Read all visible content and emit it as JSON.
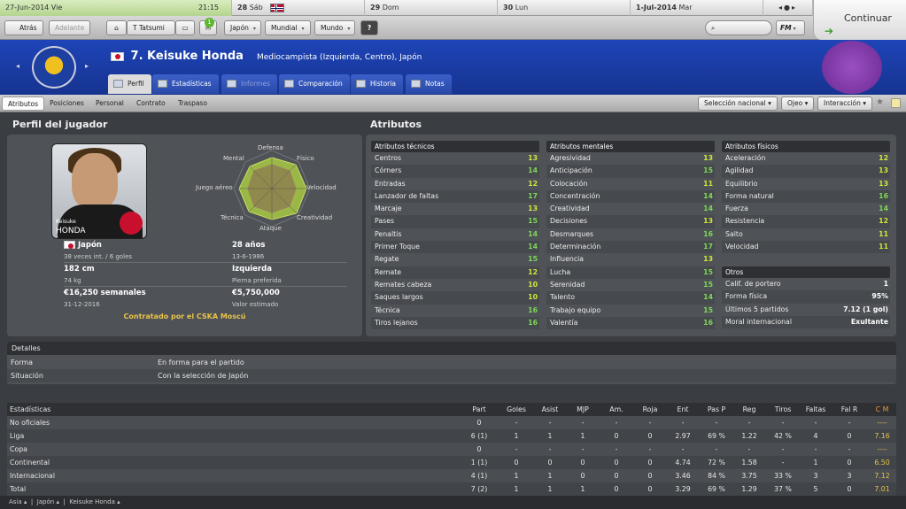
{
  "datebar": {
    "current_date": "27-Jun-2014 Vie",
    "time": "21:15",
    "days": [
      {
        "num": "28",
        "day": "Sáb"
      },
      {
        "num": "29",
        "day": "Dom"
      },
      {
        "num": "30",
        "day": "Lun"
      },
      {
        "num": "1-Jul-2014",
        "day": "Mar"
      }
    ]
  },
  "toolbar": {
    "back": "Atrás",
    "forward": "Adelante",
    "manager": "T Tatsumi",
    "badge": "1",
    "nav": [
      "Japón",
      "Mundial",
      "Mundo"
    ],
    "help": "?",
    "fm": "FM",
    "continue": "Continuar"
  },
  "header": {
    "player_number_name": "7. Keisuke Honda",
    "description": "Mediocampista (Izquierda, Centro), Japón",
    "tabs": [
      {
        "label": "Perfil"
      },
      {
        "label": "Estadísticas"
      },
      {
        "label": "Informes"
      },
      {
        "label": "Comparación"
      },
      {
        "label": "Historia"
      },
      {
        "label": "Notas"
      }
    ]
  },
  "subnav": {
    "items": [
      "Atributos",
      "Posiciones",
      "Personal",
      "Contrato",
      "Traspaso"
    ],
    "buttons": [
      "Selección nacional",
      "Ojeo",
      "Interacción"
    ]
  },
  "profile": {
    "title": "Perfil del jugador",
    "photo_first": "Keisuke",
    "photo_last": "HONDA",
    "radar": {
      "top": "Defensa",
      "tr": "Físico",
      "r": "Velocidad",
      "br": "Creatividad",
      "b": "Ataque",
      "bl": "Técnica",
      "l": "Juego aéreo",
      "tl": "Mental"
    },
    "nation": "Japón",
    "caps": "38 veces int. / 6 goles",
    "age": "28 años",
    "dob": "13-6-1986",
    "height": "182 cm",
    "weight": "74 kg",
    "foot": "Izquierda",
    "foot_label": "Pierna preferida",
    "wage": "€16,250 semanales",
    "contract_end": "31-12-2016",
    "value": "€5,750,000",
    "value_label": "Valor estimado",
    "contracted": "Contratado por el CSKA Moscú"
  },
  "attributes": {
    "title": "Atributos",
    "technical": {
      "header": "Atributos técnicos",
      "rows": [
        [
          "Centros",
          "13"
        ],
        [
          "Córners",
          "14"
        ],
        [
          "Entradas",
          "12"
        ],
        [
          "Lanzador de faltas",
          "17"
        ],
        [
          "Marcaje",
          "13"
        ],
        [
          "Pases",
          "15"
        ],
        [
          "Penaltis",
          "14"
        ],
        [
          "Primer Toque",
          "14"
        ],
        [
          "Regate",
          "15"
        ],
        [
          "Remate",
          "12"
        ],
        [
          "Remates cabeza",
          "10"
        ],
        [
          "Saques largos",
          "10"
        ],
        [
          "Técnica",
          "16"
        ],
        [
          "Tiros lejanos",
          "16"
        ]
      ]
    },
    "mental": {
      "header": "Atributos mentales",
      "rows": [
        [
          "Agresividad",
          "13"
        ],
        [
          "Anticipación",
          "15"
        ],
        [
          "Colocación",
          "11"
        ],
        [
          "Concentración",
          "14"
        ],
        [
          "Creatividad",
          "14"
        ],
        [
          "Decisiones",
          "13"
        ],
        [
          "Desmarques",
          "16"
        ],
        [
          "Determinación",
          "17"
        ],
        [
          "Influencia",
          "13"
        ],
        [
          "Lucha",
          "15"
        ],
        [
          "Serenidad",
          "15"
        ],
        [
          "Talento",
          "14"
        ],
        [
          "Trabajo equipo",
          "15"
        ],
        [
          "Valentía",
          "16"
        ]
      ]
    },
    "physical": {
      "header": "Atributos físicos",
      "rows": [
        [
          "Aceleración",
          "12"
        ],
        [
          "Agilidad",
          "13"
        ],
        [
          "Equilibrio",
          "13"
        ],
        [
          "Forma natural",
          "16"
        ],
        [
          "Fuerza",
          "14"
        ],
        [
          "Resistencia",
          "12"
        ],
        [
          "Salto",
          "11"
        ],
        [
          "Velocidad",
          "11"
        ]
      ]
    },
    "others": {
      "header": "Otros",
      "rows": [
        [
          "Calif. de portero",
          "1"
        ],
        [
          "Forma física",
          "95%"
        ],
        [
          "Últimos 5 partidos",
          "7.12 (1 gol)"
        ],
        [
          "Moral internacional",
          "Exultante"
        ]
      ]
    }
  },
  "details": {
    "header": "Detalles",
    "rows": [
      [
        "Forma",
        "En forma para el partido"
      ],
      [
        "Situación",
        "Con la selección de Japón"
      ]
    ]
  },
  "stats": {
    "headers": [
      "Estadísticas",
      "Part",
      "Goles",
      "Asist",
      "MJP",
      "Am.",
      "Roja",
      "Ent",
      "Pas P",
      "Reg",
      "Tiros",
      "Faltas",
      "Fal R",
      "C M"
    ],
    "rows": [
      [
        "No oficiales",
        "0",
        "-",
        "-",
        "-",
        "-",
        "-",
        "-",
        "-",
        "-",
        "-",
        "-",
        "-",
        "----"
      ],
      [
        "Liga",
        "6 (1)",
        "1",
        "1",
        "1",
        "0",
        "0",
        "2.97",
        "69 %",
        "1.22",
        "42 %",
        "4",
        "0",
        "7.16"
      ],
      [
        "Copa",
        "0",
        "-",
        "-",
        "-",
        "-",
        "-",
        "-",
        "-",
        "-",
        "-",
        "-",
        "-",
        "----"
      ],
      [
        "Continental",
        "1 (1)",
        "0",
        "0",
        "0",
        "0",
        "0",
        "4.74",
        "72 %",
        "1.58",
        "-",
        "1",
        "0",
        "6.50"
      ],
      [
        "Internacional",
        "4 (1)",
        "1",
        "1",
        "0",
        "0",
        "0",
        "3.46",
        "84 %",
        "3.75",
        "33 %",
        "3",
        "3",
        "7.12"
      ],
      [
        "Total",
        "7 (2)",
        "1",
        "1",
        "1",
        "0",
        "0",
        "3.29",
        "69 %",
        "1.29",
        "37 %",
        "5",
        "0",
        "7.01"
      ]
    ]
  },
  "footer": {
    "crumbs": [
      "Asia",
      "Japón",
      "Keisuke Honda"
    ]
  }
}
